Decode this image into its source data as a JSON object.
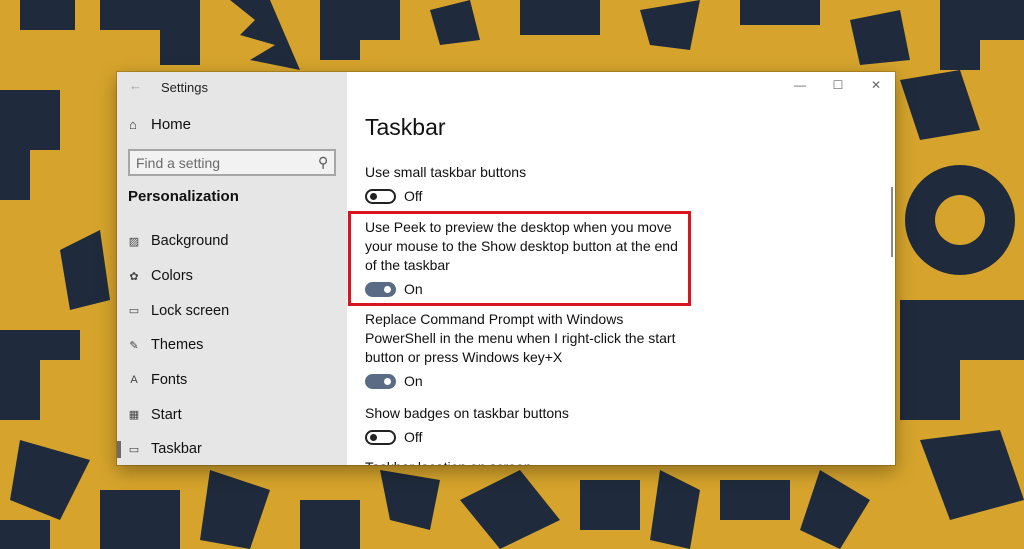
{
  "colors": {
    "wallpaper_yellow": "#d6a42c",
    "wallpaper_navy": "#1f2b3c",
    "sidebar_bg": "#e6e6e6",
    "toggle_on": "#5a6b85",
    "highlight_red": "#d9141e"
  },
  "window": {
    "title": "Settings",
    "back_icon": "back-arrow-icon",
    "controls": {
      "minimize": "—",
      "maximize": "☐",
      "close": "✕"
    }
  },
  "sidebar": {
    "home_icon": "⌂",
    "home_label": "Home",
    "search_placeholder": "Find a setting",
    "search_icon": "⚲",
    "section_title": "Personalization",
    "items": [
      {
        "label": "Background",
        "icon": "▨",
        "active": false
      },
      {
        "label": "Colors",
        "icon": "✿",
        "active": false
      },
      {
        "label": "Lock screen",
        "icon": "▭",
        "active": false
      },
      {
        "label": "Themes",
        "icon": "✎",
        "active": false
      },
      {
        "label": "Fonts",
        "icon": "A",
        "active": false
      },
      {
        "label": "Start",
        "icon": "▦",
        "active": false
      },
      {
        "label": "Taskbar",
        "icon": "▭",
        "active": true
      }
    ]
  },
  "main": {
    "title": "Taskbar",
    "settings": [
      {
        "label": "Use small taskbar buttons",
        "state": "Off"
      },
      {
        "label": "Use Peek to preview the desktop when you move your mouse to the Show desktop button at the end of the taskbar",
        "state": "On",
        "highlighted": true
      },
      {
        "label": "Replace Command Prompt with Windows PowerShell in the menu when I right-click the start button or press Windows key+X",
        "state": "On"
      },
      {
        "label": "Show badges on taskbar buttons",
        "state": "Off"
      },
      {
        "label": "Taskbar location on screen",
        "state": ""
      }
    ]
  }
}
